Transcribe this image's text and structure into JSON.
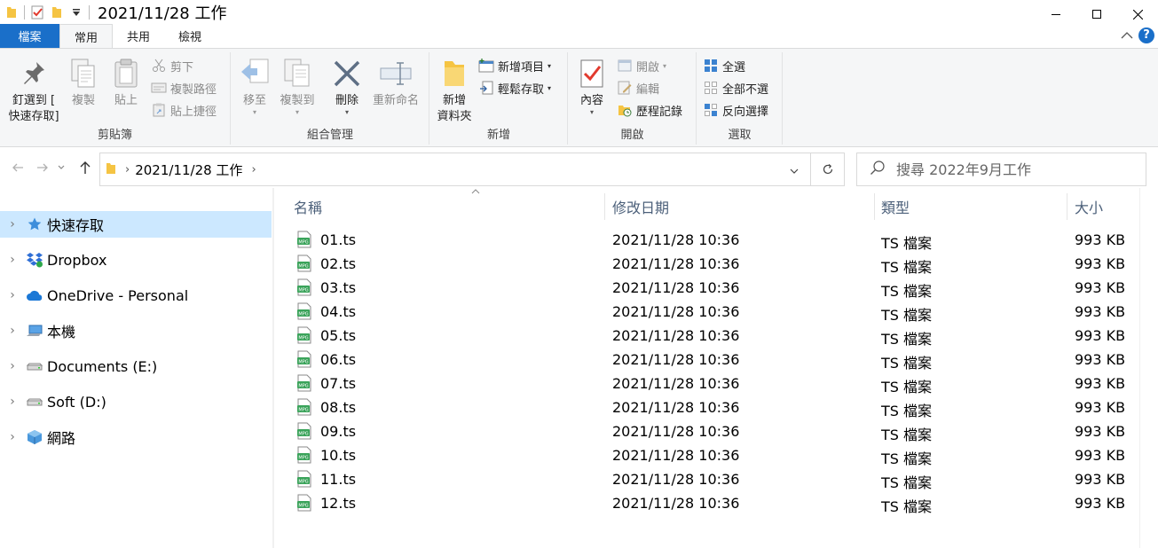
{
  "window": {
    "title": "2021/11/28 工作"
  },
  "tabs": [
    {
      "label": "檔案"
    },
    {
      "label": "常用"
    },
    {
      "label": "共用"
    },
    {
      "label": "檢視"
    }
  ],
  "ribbon": {
    "clipboard": {
      "label": "剪貼簿",
      "pin_line1": "釘選到 [",
      "pin_line2": "快速存取]",
      "copy": "複製",
      "paste": "貼上",
      "cut": "剪下",
      "copy_path": "複製路徑",
      "paste_shortcut": "貼上捷徑"
    },
    "organize": {
      "label": "組合管理",
      "move_to": "移至",
      "copy_to": "複製到",
      "delete": "刪除",
      "rename": "重新命名"
    },
    "new": {
      "label": "新增",
      "new_folder_line1": "新增",
      "new_folder_line2": "資料夾",
      "new_item": "新增項目",
      "easy_access": "輕鬆存取"
    },
    "open": {
      "label": "開啟",
      "properties": "內容",
      "open": "開啟",
      "edit": "編輯",
      "history": "歷程記錄"
    },
    "select": {
      "label": "選取",
      "select_all": "全選",
      "select_none": "全部不選",
      "invert": "反向選擇"
    }
  },
  "address": {
    "path": "2021/11/28 工作",
    "search_placeholder": "搜尋 2022年9月工作"
  },
  "sidebar": {
    "items": [
      {
        "label": "快速存取"
      },
      {
        "label": "Dropbox"
      },
      {
        "label": "OneDrive - Personal"
      },
      {
        "label": "本機"
      },
      {
        "label": "Documents (E:)"
      },
      {
        "label": "Soft (D:)"
      },
      {
        "label": "網路"
      }
    ]
  },
  "columns": {
    "name": "名稱",
    "modified": "修改日期",
    "type": "類型",
    "size": "大小"
  },
  "files": [
    {
      "name": "01.ts",
      "modified": "2021/11/28 10:36",
      "type": "TS 檔案",
      "size": "993 KB"
    },
    {
      "name": "02.ts",
      "modified": "2021/11/28 10:36",
      "type": "TS 檔案",
      "size": "993 KB"
    },
    {
      "name": "03.ts",
      "modified": "2021/11/28 10:36",
      "type": "TS 檔案",
      "size": "993 KB"
    },
    {
      "name": "04.ts",
      "modified": "2021/11/28 10:36",
      "type": "TS 檔案",
      "size": "993 KB"
    },
    {
      "name": "05.ts",
      "modified": "2021/11/28 10:36",
      "type": "TS 檔案",
      "size": "993 KB"
    },
    {
      "name": "06.ts",
      "modified": "2021/11/28 10:36",
      "type": "TS 檔案",
      "size": "993 KB"
    },
    {
      "name": "07.ts",
      "modified": "2021/11/28 10:36",
      "type": "TS 檔案",
      "size": "993 KB"
    },
    {
      "name": "08.ts",
      "modified": "2021/11/28 10:36",
      "type": "TS 檔案",
      "size": "993 KB"
    },
    {
      "name": "09.ts",
      "modified": "2021/11/28 10:36",
      "type": "TS 檔案",
      "size": "993 KB"
    },
    {
      "name": "10.ts",
      "modified": "2021/11/28 10:36",
      "type": "TS 檔案",
      "size": "993 KB"
    },
    {
      "name": "11.ts",
      "modified": "2021/11/28 10:36",
      "type": "TS 檔案",
      "size": "993 KB"
    },
    {
      "name": "12.ts",
      "modified": "2021/11/28 10:36",
      "type": "TS 檔案",
      "size": "993 KB"
    }
  ],
  "icons": {
    "file": "mpg-file-icon",
    "folder": "folder-icon"
  },
  "colors": {
    "accent": "#1a6fc9",
    "selection": "#cce8ff",
    "header_text": "#4c607a"
  }
}
